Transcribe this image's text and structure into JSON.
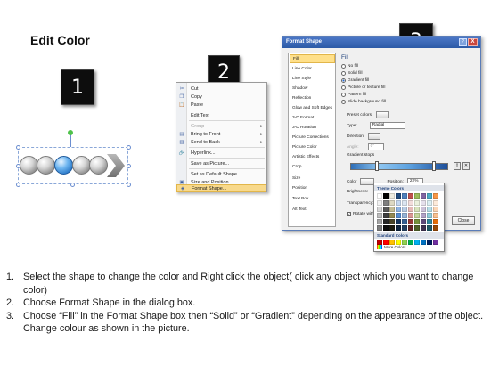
{
  "title": "Edit Color",
  "badges": [
    "1",
    "2",
    "3"
  ],
  "context_menu": [
    {
      "label": "Cut",
      "icon": "✂",
      "state": "normal"
    },
    {
      "label": "Copy",
      "icon": "❐",
      "state": "normal"
    },
    {
      "label": "Paste",
      "icon": "📋",
      "state": "normal"
    },
    {
      "label": "Edit Text",
      "icon": "",
      "state": "normal"
    },
    {
      "label": "Group",
      "icon": "",
      "state": "dim",
      "submenu": true
    },
    {
      "label": "Bring to Front",
      "icon": "▤",
      "state": "normal",
      "submenu": true
    },
    {
      "label": "Send to Back",
      "icon": "▥",
      "state": "normal",
      "submenu": true
    },
    {
      "label": "Hyperlink...",
      "icon": "🔗",
      "state": "normal"
    },
    {
      "label": "Save as Picture...",
      "icon": "",
      "state": "normal"
    },
    {
      "label": "Set as Default Shape",
      "icon": "",
      "state": "normal"
    },
    {
      "label": "Size and Position...",
      "icon": "▣",
      "state": "normal"
    },
    {
      "label": "Format Shape...",
      "icon": "◈",
      "state": "highlighted"
    }
  ],
  "dialog": {
    "title": "Format Shape",
    "help": "?",
    "close_x": "X",
    "nav": [
      "Fill",
      "Line Color",
      "Line Style",
      "Shadow",
      "Reflection",
      "Glow and Soft Edges",
      "3-D Format",
      "3-D Rotation",
      "Picture Corrections",
      "Picture Color",
      "Artistic Effects",
      "Crop",
      "Size",
      "Position",
      "Text Box",
      "Alt Text"
    ],
    "fill_heading": "Fill",
    "fill_options": [
      {
        "label": "No fill",
        "selected": false
      },
      {
        "label": "Solid fill",
        "selected": false
      },
      {
        "label": "Gradient fill",
        "selected": true
      },
      {
        "label": "Picture or texture fill",
        "selected": false
      },
      {
        "label": "Pattern fill",
        "selected": false
      },
      {
        "label": "Slide background fill",
        "selected": false
      }
    ],
    "preset_colors": "Preset colors:",
    "type_label": "Type:",
    "type_value": "Radial",
    "direction_label": "Direction:",
    "angle_label": "Angle:",
    "angle_value": "0°",
    "gradient_stops": "Gradient stops",
    "color_label": "Color",
    "position_label": "Position:",
    "position_value": "22%",
    "brightness_label": "Brightness:",
    "transparency_label": "Transparency:",
    "rotate_label": "Rotate with shape",
    "close_button": "Close"
  },
  "palette": {
    "theme_heading": "Theme Colors",
    "theme_top": [
      "#ffffff",
      "#000000",
      "#eeece1",
      "#1f497d",
      "#4f81bd",
      "#c0504d",
      "#9bbb59",
      "#8064a2",
      "#4bacc6",
      "#f79646"
    ],
    "theme_rows": [
      [
        "#f2f2f2",
        "#7f7f7f",
        "#ddd9c3",
        "#c6d9f0",
        "#dbe5f1",
        "#f2dcdb",
        "#ebf1dd",
        "#e5e0ec",
        "#dbeef3",
        "#fdeada"
      ],
      [
        "#d8d8d8",
        "#595959",
        "#c4bd97",
        "#8db3e2",
        "#b8cce4",
        "#e5b9b7",
        "#d7e3bc",
        "#ccc1d9",
        "#b7dde8",
        "#fbd5b5"
      ],
      [
        "#bfbfbf",
        "#3f3f3f",
        "#938953",
        "#548dd4",
        "#95b3d7",
        "#d99694",
        "#c3d69b",
        "#b2a2c7",
        "#92cddc",
        "#fac08f"
      ],
      [
        "#a5a5a5",
        "#262626",
        "#494429",
        "#17365d",
        "#366092",
        "#953734",
        "#76923c",
        "#5f497a",
        "#31859b",
        "#e36c09"
      ],
      [
        "#7f7f7f",
        "#0c0c0c",
        "#1d1b10",
        "#0f243e",
        "#244061",
        "#632423",
        "#4f6128",
        "#3f3151",
        "#205867",
        "#974806"
      ]
    ],
    "standard_heading": "Standard Colors",
    "standard": [
      "#c00000",
      "#ff0000",
      "#ffc000",
      "#ffff00",
      "#92d050",
      "#00b050",
      "#00b0f0",
      "#0070c0",
      "#002060",
      "#7030a0"
    ],
    "more_colors": "More Colors..."
  },
  "steps": [
    {
      "num": "1.",
      "text": "Select the shape to change the color and Right click the object( click any object which you want to change color)"
    },
    {
      "num": "2.",
      "text": "Choose Format Shape in the dialog box."
    },
    {
      "num": "3.",
      "text": "Choose “Fill” in the Format Shape box then “Solid” or “Gradient” depending on the appearance of the object. Change colour as shown in the picture."
    }
  ]
}
